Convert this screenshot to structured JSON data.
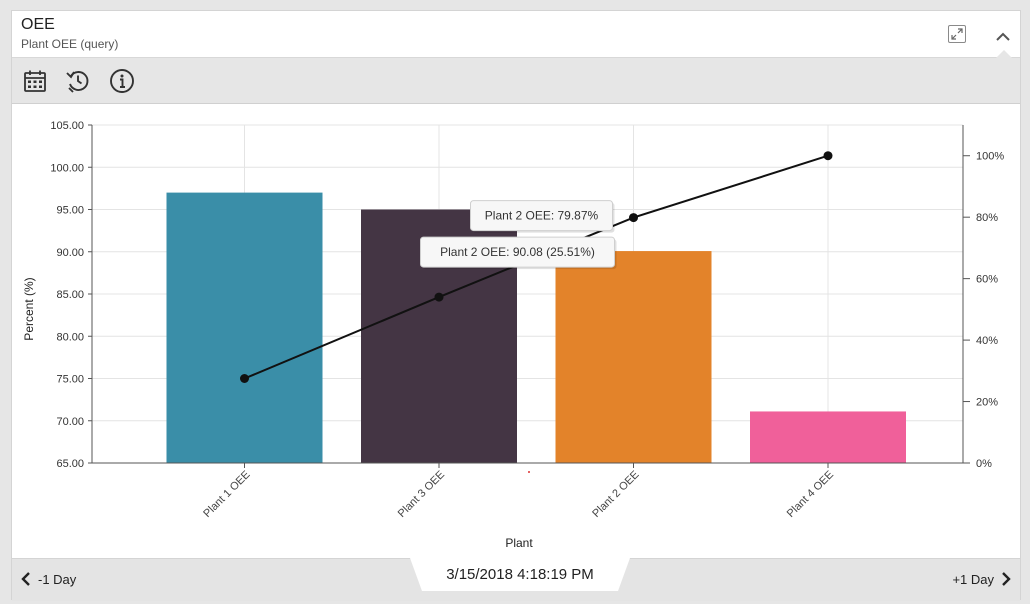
{
  "header": {
    "title": "OEE",
    "subtitle": "Plant OEE (query)"
  },
  "toolbar": {
    "icons": [
      "calendar-icon",
      "history-icon",
      "info-icon"
    ]
  },
  "chart_data": {
    "type": "bar",
    "xlabel": "Plant",
    "ylabel": "Percent (%)",
    "categories": [
      "Plant 1 OEE",
      "Plant 3 OEE",
      "Plant 2 OEE",
      "Plant 4 OEE"
    ],
    "series": [
      {
        "values": [
          97.0,
          95.0,
          90.08,
          71.1
        ],
        "colors": [
          "#3a8ea8",
          "#443544",
          "#e3832a",
          "#f0609a"
        ]
      },
      {
        "type": "line",
        "axis": "right",
        "values": [
          27.5,
          54.0,
          79.87,
          100.0
        ]
      }
    ],
    "ylim": [
      65,
      105
    ],
    "yticks": [
      "65.00",
      "70.00",
      "75.00",
      "80.00",
      "85.00",
      "90.00",
      "95.00",
      "100.00",
      "105.00"
    ],
    "y2lim": [
      0,
      110
    ],
    "y2ticks": [
      "0%",
      "20%",
      "40%",
      "60%",
      "80%",
      "100%"
    ],
    "grid": true,
    "tooltips": [
      "Plant 2 OEE: 79.87%",
      "Plant 2 OEE: 90.08 (25.51%)"
    ]
  },
  "footer": {
    "prev_label": "-1 Day",
    "next_label": "+1 Day",
    "datetime": "3/15/2018 4:18:19 PM"
  }
}
